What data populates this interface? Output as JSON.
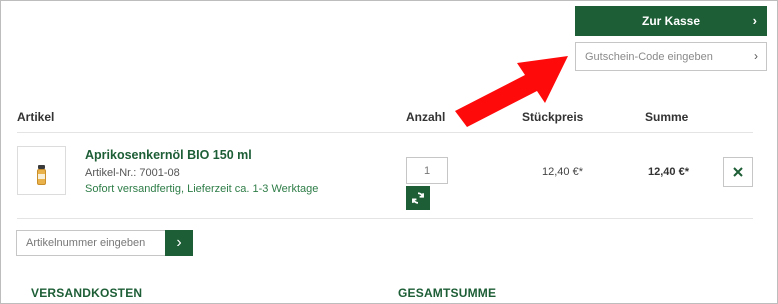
{
  "checkout": {
    "label": "Zur Kasse",
    "chevron": "›"
  },
  "voucher": {
    "placeholder": "Gutschein-Code eingeben",
    "chevron": "›"
  },
  "table_headers": {
    "artikel": "Artikel",
    "anzahl": "Anzahl",
    "stueckpreis": "Stückpreis",
    "summe": "Summe"
  },
  "item": {
    "name": "Aprikosenkernöl BIO 150 ml",
    "article_number": "Artikel-Nr.: 7001-08",
    "shipping": "Sofort versandfertig, Lieferzeit ca. 1-3 Werktage",
    "quantity": "1",
    "unit_price": "12,40 €*",
    "total": "12,40 €*"
  },
  "article_input": {
    "placeholder": "Artikelnummer eingeben",
    "chevron": "›"
  },
  "sections": {
    "shipping_costs": "VERSANDKOSTEN",
    "grand_total": "GESAMTSUMME"
  },
  "colors": {
    "brand_green": "#1d5e36",
    "annotation_arrow": "#ff0a0a"
  },
  "icons": {
    "refresh": "refresh-icon",
    "remove": "close-icon",
    "arrow": "red-arrow-annotation"
  }
}
